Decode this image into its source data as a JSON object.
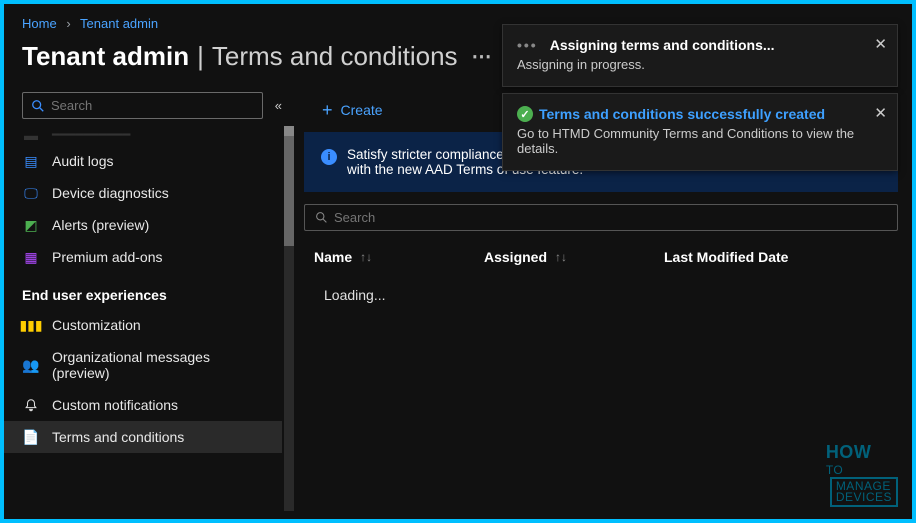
{
  "breadcrumb": {
    "home": "Home",
    "current": "Tenant admin"
  },
  "page": {
    "title_strong": "Tenant admin",
    "title_light": "Terms and conditions"
  },
  "sidebar": {
    "search_placeholder": "Search",
    "items": [
      {
        "label": "Audit logs"
      },
      {
        "label": "Device diagnostics"
      },
      {
        "label": "Alerts (preview)"
      },
      {
        "label": "Premium add-ons"
      }
    ],
    "section_heading": "End user experiences",
    "section_items": [
      {
        "label": "Customization"
      },
      {
        "label": "Organizational messages (preview)"
      },
      {
        "label": "Custom notifications"
      },
      {
        "label": "Terms and conditions"
      }
    ]
  },
  "commands": {
    "create": "Create"
  },
  "banner": {
    "text": "Satisfy stricter compliance\nwith the new AAD Terms of use feature."
  },
  "main_search_placeholder": "Search",
  "table": {
    "columns": {
      "name": "Name",
      "assigned": "Assigned",
      "modified": "Last Modified Date"
    },
    "loading": "Loading..."
  },
  "toasts": {
    "assigning": {
      "title": "Assigning terms and conditions...",
      "body": "Assigning in progress."
    },
    "created": {
      "title": "Terms and conditions successfully created",
      "body": "Go to HTMD Community Terms and Conditions to view the details."
    }
  }
}
